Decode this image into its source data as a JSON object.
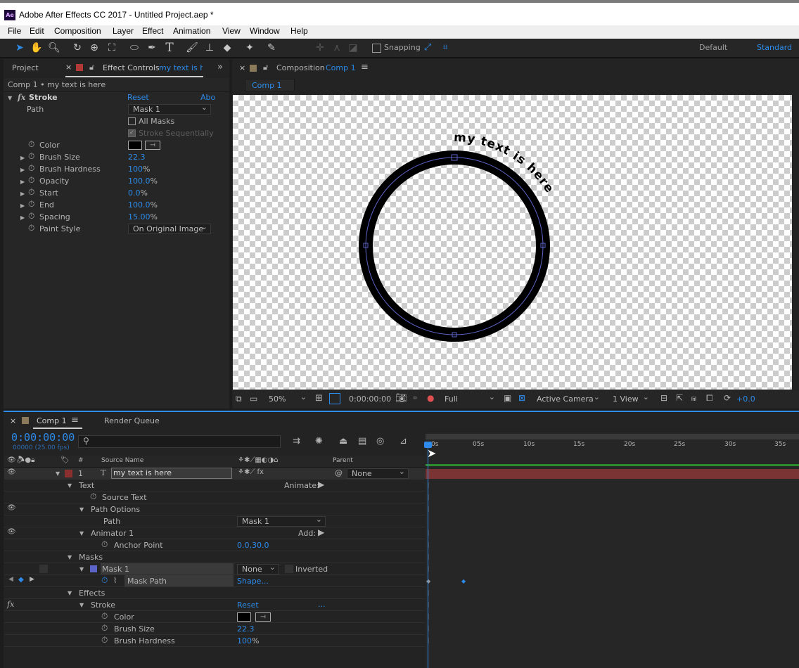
{
  "window": {
    "title": "Adobe After Effects CC 2017 - Untitled Project.aep *",
    "app_icon": "Ae"
  },
  "menu": [
    "File",
    "Edit",
    "Composition",
    "Layer",
    "Effect",
    "Animation",
    "View",
    "Window",
    "Help"
  ],
  "toolbar": {
    "snapping_label": "Snapping",
    "workspace_default": "Default",
    "workspace_standard": "Standard"
  },
  "left_panel": {
    "tab_project": "Project",
    "tab_effect_controls": "Effect Controls",
    "tab_layer_name": "my text is h",
    "breadcrumb": "Comp 1 • my text is here",
    "effect_name": "Stroke",
    "reset": "Reset",
    "about": "Abo",
    "props": {
      "path_label": "Path",
      "path_value": "Mask 1",
      "all_masks": "All Masks",
      "stroke_sequentially": "Stroke Sequentially",
      "color": "Color",
      "brush_size": "Brush Size",
      "brush_size_val": "22.3",
      "brush_hardness": "Brush Hardness",
      "brush_hardness_val": "100",
      "opacity": "Opacity",
      "opacity_val": "100.0",
      "start": "Start",
      "start_val": "0.0",
      "end": "End",
      "end_val": "100.0",
      "spacing": "Spacing",
      "spacing_val": "15.00",
      "paint_style": "Paint Style",
      "paint_style_val": "On Original Image",
      "pct": "%"
    }
  },
  "comp_panel": {
    "tab_prefix": "Composition",
    "tab_comp": "Comp 1",
    "subtab": "Comp 1",
    "circle_text": "my text is here",
    "footer": {
      "zoom": "50%",
      "timecode": "0:00:00:00",
      "resolution": "Full",
      "camera": "Active Camera",
      "views": "1 View",
      "exposure": "+0.0"
    }
  },
  "timeline": {
    "tab_comp": "Comp 1",
    "tab_render": "Render Queue",
    "timecode": "0:00:00:00",
    "timecode_sub": "00000 (25.00 fps)",
    "col_source": "Source Name",
    "col_parent": "Parent",
    "ruler": [
      "0s",
      "05s",
      "10s",
      "15s",
      "20s",
      "25s",
      "30s",
      "35s"
    ],
    "layer": {
      "num": "1",
      "type_icon": "T",
      "name": "my text is here",
      "parent": "None"
    },
    "rows": {
      "text": "Text",
      "animate": "Animate:",
      "source_text": "Source Text",
      "path_options": "Path Options",
      "path": "Path",
      "path_val": "Mask 1",
      "animator": "Animator 1",
      "add": "Add:",
      "anchor": "Anchor Point",
      "anchor_val": "0.0,30.0",
      "masks": "Masks",
      "mask1": "Mask 1",
      "mask_mode": "None",
      "inverted": "Inverted",
      "mask_path": "Mask Path",
      "mask_path_val": "Shape...",
      "effects": "Effects",
      "stroke": "Stroke",
      "reset": "Reset",
      "dots": "...",
      "color": "Color",
      "brush_size": "Brush Size",
      "brush_size_val": "22.3",
      "brush_hardness": "Brush Hardness",
      "brush_hardness_val": "100",
      "pct": "%"
    }
  },
  "colors": {
    "accent": "#2d8ceb",
    "layer_label": "#8b2e2e",
    "mask_color": "#5d64c8"
  }
}
